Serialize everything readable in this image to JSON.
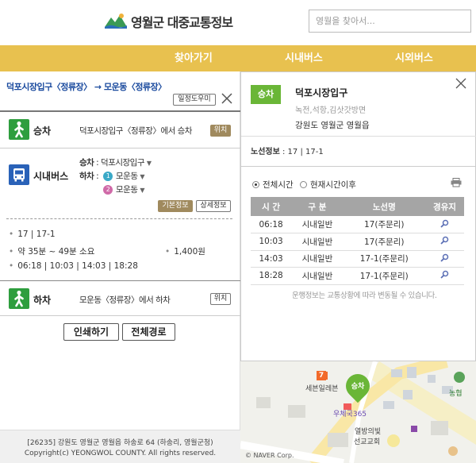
{
  "header": {
    "logo_text": "영월군 대중교통정보",
    "search_placeholder": "영월을 찾아서..."
  },
  "nav": {
    "items": [
      "찾아가기",
      "시내버스",
      "시외버스"
    ]
  },
  "route": {
    "title": "덕포시장입구〈정류장〉 → 모운동〈정류장〉",
    "timetable_button": "일정도우미"
  },
  "steps": {
    "board": {
      "label": "승차",
      "text": "덕포시장입구〈정류장〉에서 승차",
      "position_button": "위치"
    },
    "bus": {
      "label": "시내버스",
      "board_line_label": "승차",
      "board_line_value": ": 덕포시장입구",
      "alight_line_label": "하차",
      "alight_options": [
        {
          "num": "1",
          "name": "모운동",
          "color": "#3aa9c7"
        },
        {
          "num": "2",
          "name": "모운동",
          "color": "#d06aa8"
        }
      ],
      "basic_info_button": "기본정보",
      "detail_info_button": "상세정보"
    },
    "info": {
      "routes": "17 | 17-1",
      "duration": "약 35분 ~ 49분 소요",
      "fare": "1,400원",
      "times": "06:18 | 10:03 | 14:03 | 18:28"
    },
    "alight": {
      "label": "하차",
      "text": "모운동〈정류장〉에서 하차",
      "position_button": "위치"
    }
  },
  "actions": {
    "print": "인쇄하기",
    "full_route": "전체경로"
  },
  "footer": {
    "address": "[26235] 강원도 영월군 영월읍 하송로 64 (하송리, 영월군청)",
    "copyright": "Copyright(c) YEONGWOL COUNTY. All rights reserved."
  },
  "popup": {
    "badge": "승차",
    "stop_name": "덕포시장입구",
    "stop_sub": "녹전,석항,김삿갓방면",
    "stop_addr": "강원도 영월군 영월읍",
    "route_info_label": "노선정보",
    "route_info_value": " : 17 | 17-1",
    "radio_all": "전체시간",
    "radio_after": "현재시간이후",
    "table": {
      "headers": [
        "시 간",
        "구 분",
        "노선명",
        "경유지"
      ],
      "rows": [
        [
          "06:18",
          "시내일반",
          "17(주문리)"
        ],
        [
          "10:03",
          "시내일반",
          "17(주문리)"
        ],
        [
          "14:03",
          "시내일반",
          "17-1(주문리)"
        ],
        [
          "18:28",
          "시내일반",
          "17-1(주문리)"
        ]
      ]
    },
    "note": "운행정보는 교통상황에 따라 변동될 수 있습니다."
  },
  "map": {
    "marker_label": "승차",
    "labels": [
      "세븐일레븐",
      "우체국365",
      "농협",
      "열방의빛",
      "선교교회"
    ],
    "copyright": "© NAVER Corp.",
    "store_sign": "7"
  }
}
